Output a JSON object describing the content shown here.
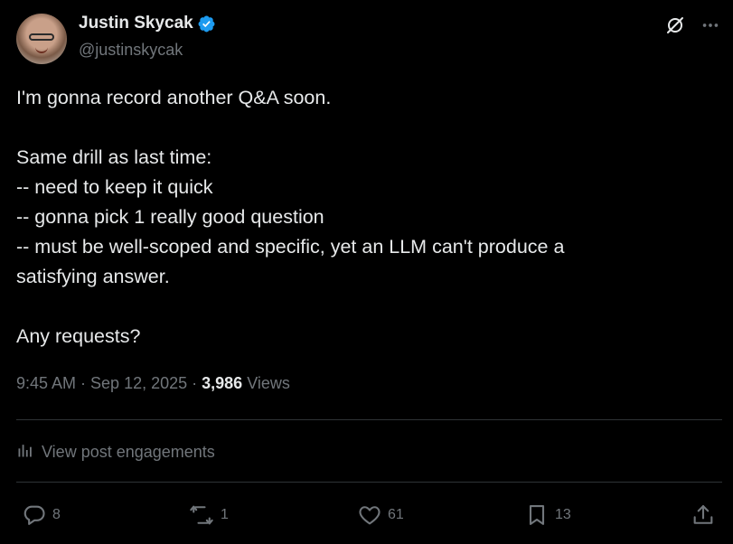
{
  "author": {
    "display_name": "Justin Skycak",
    "handle": "@justinskycak",
    "verified": true
  },
  "post": {
    "lines": [
      "I'm gonna record another Q&A soon.",
      "",
      "Same drill as last time:",
      "-- need to keep it quick",
      "-- gonna pick 1 really good question",
      "-- must be well-scoped and specific, yet an LLM can't produce a",
      "satisfying answer.",
      "",
      "Any requests?"
    ],
    "timestamp": "9:45 AM · Sep 12, 2025 · ",
    "views_count": "3,986",
    "views_label": " Views"
  },
  "engagements_label": "View post engagements",
  "actions": {
    "replies": "8",
    "reposts": "1",
    "likes": "61",
    "bookmarks": "13"
  },
  "icons": {
    "top": [
      "grok-icon",
      "more-icon"
    ],
    "engagements": "analytics-icon",
    "actions": [
      "reply-icon",
      "repost-icon",
      "like-icon",
      "bookmark-icon",
      "share-icon"
    ]
  },
  "colors": {
    "background": "#000000",
    "text": "#e7e9ea",
    "muted": "#71767b",
    "verified": "#1d9bf0",
    "divider": "#2f3336"
  }
}
